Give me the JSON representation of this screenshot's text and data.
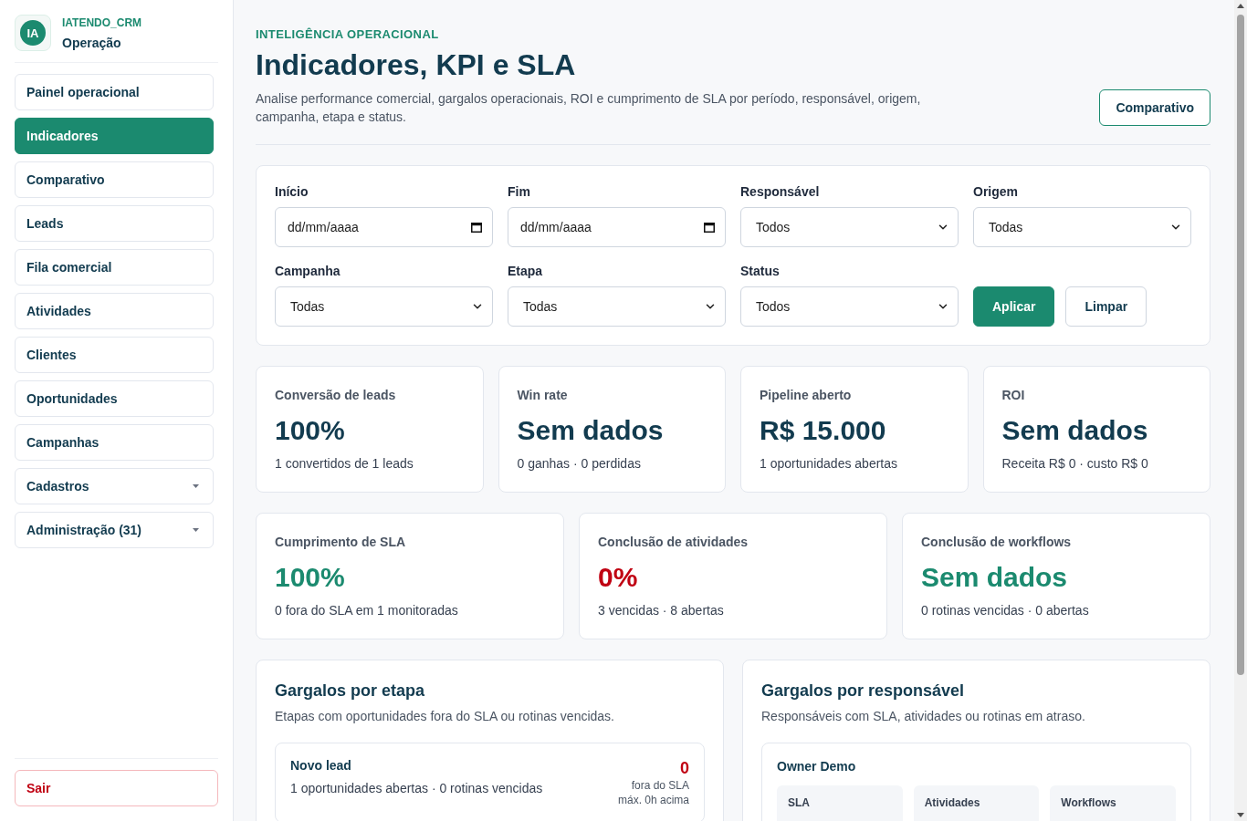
{
  "sidebar": {
    "brand": {
      "logo": "IA",
      "name": "IATENDO_CRM",
      "section": "Operação"
    },
    "items": [
      {
        "label": "Painel operacional",
        "kind": "link",
        "selected": false
      },
      {
        "label": "Indicadores",
        "kind": "link",
        "selected": true
      },
      {
        "label": "Comparativo",
        "kind": "link",
        "selected": false
      },
      {
        "label": "Leads",
        "kind": "link",
        "selected": false
      },
      {
        "label": "Fila comercial",
        "kind": "link",
        "selected": false
      },
      {
        "label": "Atividades",
        "kind": "link",
        "selected": false
      },
      {
        "label": "Clientes",
        "kind": "link",
        "selected": false
      },
      {
        "label": "Oportunidades",
        "kind": "link",
        "selected": false
      },
      {
        "label": "Campanhas",
        "kind": "link",
        "selected": false
      },
      {
        "label": "Cadastros",
        "kind": "group",
        "selected": false,
        "expanded": false
      },
      {
        "label": "Administração (31)",
        "kind": "group",
        "selected": false,
        "expanded": false
      }
    ],
    "logout": "Sair"
  },
  "header": {
    "eyebrow": "INTELIGÊNCIA OPERACIONAL",
    "title": "Indicadores, KPI e SLA",
    "description": "Analise performance comercial, gargalos operacionais, ROI e cumprimento de SLA por período, responsável, origem, campanha, etapa e status.",
    "action": "Comparativo"
  },
  "filters": {
    "fields": [
      {
        "label": "Início",
        "kind": "date",
        "placeholder": "dd/mm/aaaa"
      },
      {
        "label": "Fim",
        "kind": "date",
        "placeholder": "dd/mm/aaaa"
      },
      {
        "label": "Responsável",
        "kind": "select",
        "value": "Todos"
      },
      {
        "label": "Origem",
        "kind": "select",
        "value": "Todas"
      },
      {
        "label": "Campanha",
        "kind": "select",
        "value": "Todas"
      },
      {
        "label": "Etapa",
        "kind": "select",
        "value": "Todas"
      },
      {
        "label": "Status",
        "kind": "select",
        "value": "Todos"
      }
    ],
    "buttons": [
      {
        "label": "Aplicar",
        "kind": "primary"
      },
      {
        "label": "Limpar",
        "kind": "secondary"
      }
    ]
  },
  "kpi_cards": [
    {
      "title": "Conversão de leads",
      "value": "100%",
      "detail": "1 convertidos de 1 leads"
    },
    {
      "title": "Win rate",
      "value": "Sem dados",
      "detail": "0 ganhas · 0 perdidas"
    },
    {
      "title": "Pipeline aberto",
      "value": "R$ 15.000",
      "detail": "1 oportunidades abertas"
    },
    {
      "title": "ROI",
      "value": "Sem dados",
      "detail": "Receita R$ 0 · custo R$ 0"
    }
  ],
  "sla_cards": [
    {
      "title": "Cumprimento de SLA",
      "value": "100%",
      "detail": "0 fora do SLA em 1 monitoradas",
      "color": "#1b8a6f"
    },
    {
      "title": "Conclusão de atividades",
      "value": "0%",
      "detail": "3 vencidas · 8 abertas",
      "color": "#c00012"
    },
    {
      "title": "Conclusão de workflows",
      "value": "Sem dados",
      "detail": "0 rotinas vencidas · 0 abertas",
      "color": "#1b8a6f"
    }
  ],
  "bottlenecks": [
    {
      "kind": "stage",
      "title": "Gargalos por etapa",
      "subtitle": "Etapas com oportunidades fora do SLA ou rotinas vencidas.",
      "items": [
        {
          "name": "Novo lead",
          "detail": "1 oportunidades abertas · 0 rotinas vencidas",
          "count": "0",
          "count_label": "fora do SLA",
          "note": "máx. 0h acima"
        }
      ]
    },
    {
      "kind": "owner",
      "title": "Gargalos por responsável",
      "subtitle": "Responsáveis com SLA, atividades ou rotinas em atraso.",
      "items": [
        {
          "name": "Owner Demo",
          "stats": [
            "SLA",
            "Atividades",
            "Workflows"
          ]
        }
      ]
    }
  ]
}
